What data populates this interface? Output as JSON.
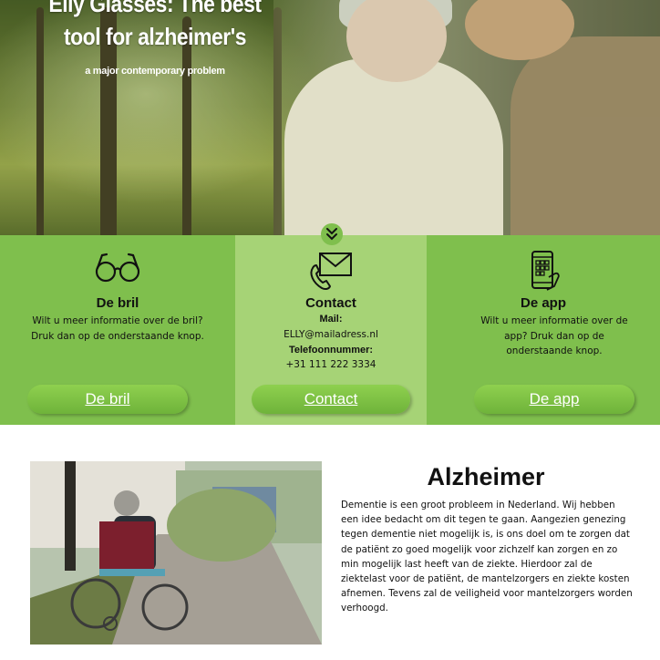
{
  "hero": {
    "title": "Elly Glasses: The best tool for alzheimer's",
    "subtitle": "a major contemporary problem"
  },
  "features": {
    "bril": {
      "icon": "glasses-icon",
      "title": "De bril",
      "text": "Wilt u meer informatie over de bril? Druk dan op de onderstaande knop.",
      "button": "De bril"
    },
    "contact": {
      "icon": "phone-mail-icon",
      "title": "Contact",
      "mail_label": "Mail:",
      "mail_value": "ELLY@mailadress.nl",
      "phone_label": "Telefoonnummer:",
      "phone_value": "+31 111 222 3334",
      "button": "Contact"
    },
    "app": {
      "icon": "smartphone-app-icon",
      "title": "De app",
      "text": "Wilt u meer informatie over de app? Druk dan op de onderstaande knop.",
      "button": "De app"
    }
  },
  "scroll_icon": "double-chevron-down-icon",
  "alzheimer": {
    "title": "Alzheimer",
    "body": "Dementie is een groot probleem in Nederland. Wij hebben een idee bedacht om dit tegen te gaan. Aangezien genezing tegen dementie niet mogelijk is, is ons doel om te zorgen dat de patiënt zo goed mogelijk voor zichzelf kan zorgen en zo min mogelijk last heeft van de ziekte. Hierdoor zal de ziektelast voor de patiënt, de mantelzorgers en ziekte kosten afnemen. Tevens zal de veiligheid voor mantelzorgers worden verhoogd."
  },
  "colors": {
    "green": "#7fbf4d",
    "light_green": "#a6d376",
    "button_green": "#6fb33a"
  }
}
